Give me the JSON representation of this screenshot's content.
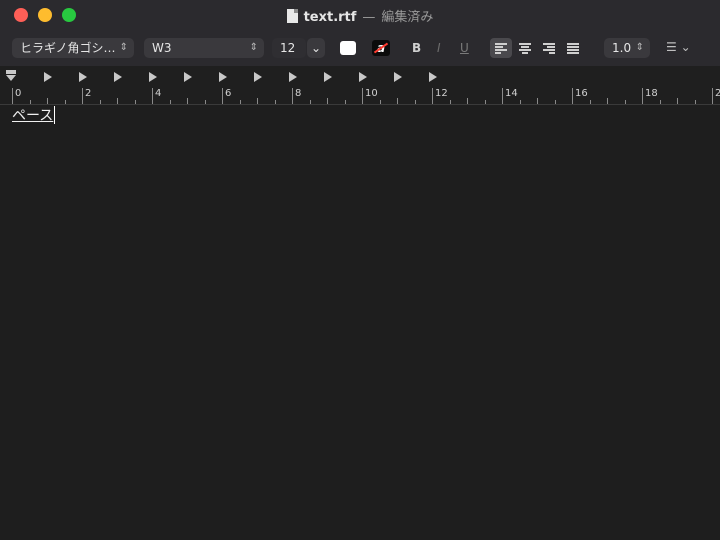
{
  "window": {
    "filename": "text.rtf",
    "separator": "—",
    "state": "編集済み"
  },
  "toolbar": {
    "font_family": "ヒラギノ角ゴシ…",
    "font_weight": "W3",
    "font_size": "12",
    "bold": "B",
    "italic": "I",
    "underline": "U",
    "line_spacing": "1.0",
    "text_color_label": "a"
  },
  "ruler": {
    "labels": [
      "0",
      "2",
      "4",
      "6",
      "8",
      "10",
      "12",
      "14",
      "16",
      "18",
      "2"
    ]
  },
  "document": {
    "text": "ペース"
  }
}
